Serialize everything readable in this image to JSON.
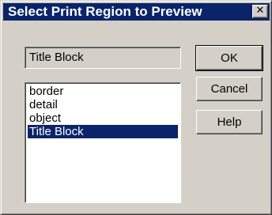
{
  "window": {
    "title": "Select Print Region to Preview",
    "close_glyph": "✕"
  },
  "selection": {
    "value": "Title Block"
  },
  "regions": [
    {
      "label": "border",
      "selected": false
    },
    {
      "label": "detail",
      "selected": false
    },
    {
      "label": "object",
      "selected": false
    },
    {
      "label": "Title Block",
      "selected": true
    }
  ],
  "buttons": {
    "ok": "OK",
    "cancel": "Cancel",
    "help": "Help"
  },
  "colors": {
    "titlebar": "#0a246a",
    "face": "#d4d0c8",
    "selection_highlight": "#0a246a"
  },
  "icons": {
    "close": "close-icon"
  }
}
